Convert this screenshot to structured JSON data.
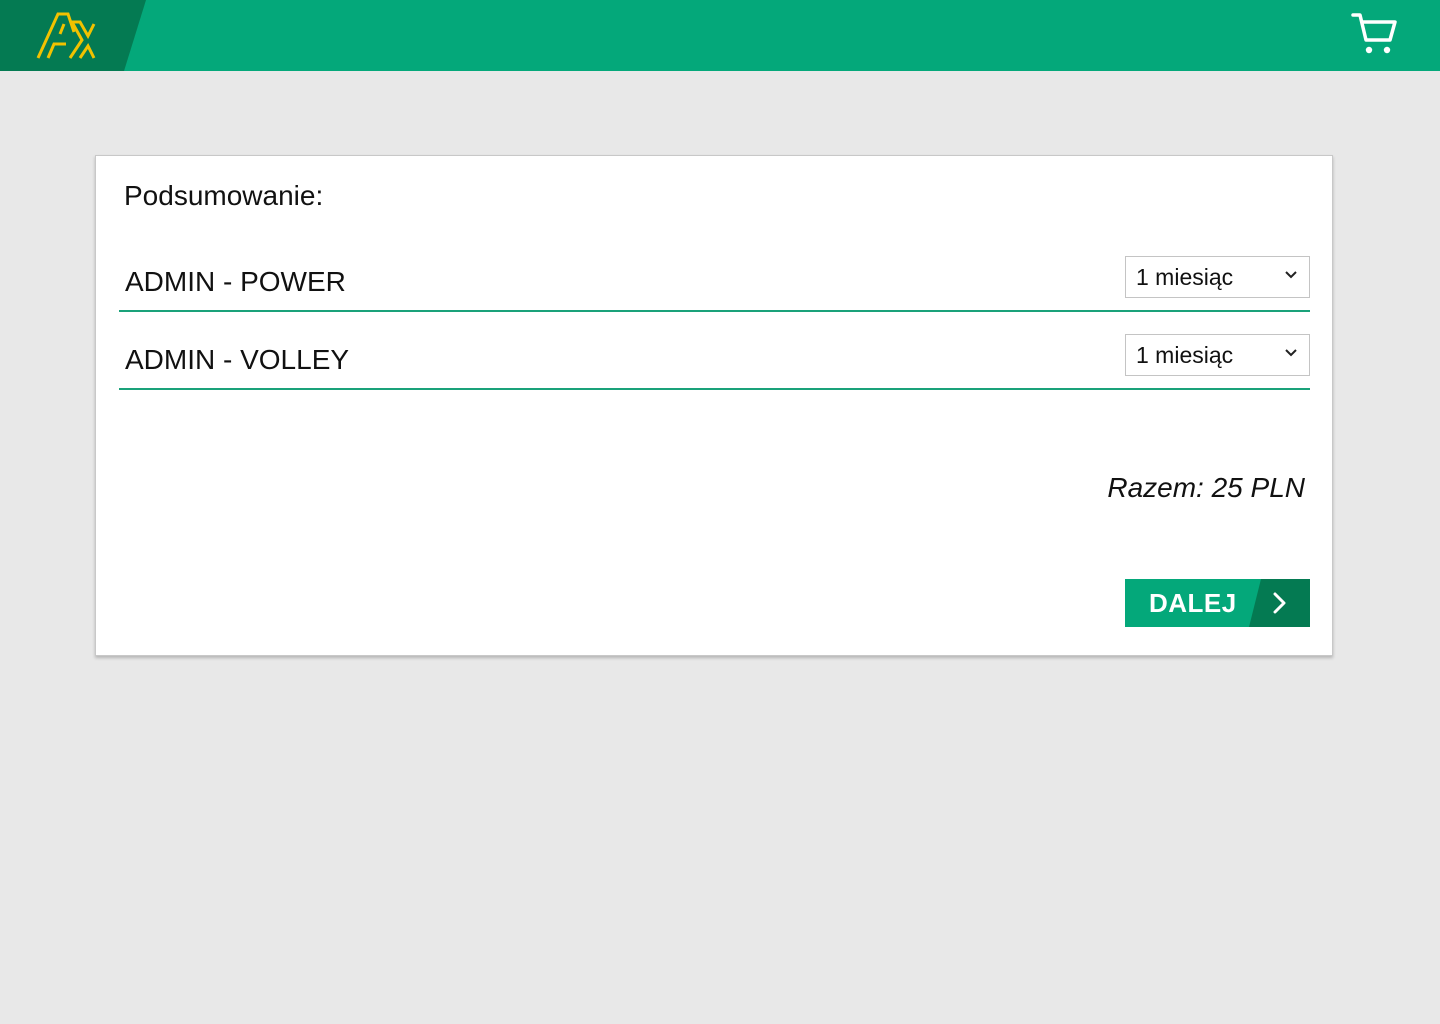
{
  "header": {
    "logo_icon": "ax-logo-icon",
    "cart_icon": "shopping-cart-icon",
    "colors": {
      "bar": "#04a87a",
      "logo_block": "#047a52",
      "logo": "#f2c200"
    }
  },
  "summary": {
    "title": "Podsumowanie:",
    "items": [
      {
        "name": "ADMIN - POWER",
        "period": "1 miesiąc"
      },
      {
        "name": "ADMIN - VOLLEY",
        "period": "1 miesiąc"
      }
    ],
    "total": "Razem: 25 PLN",
    "next_label": "DALEJ",
    "next_icon": "chevron-right-icon",
    "dropdown_icon": "chevron-down-icon",
    "accent_color": "#1aa27a"
  }
}
